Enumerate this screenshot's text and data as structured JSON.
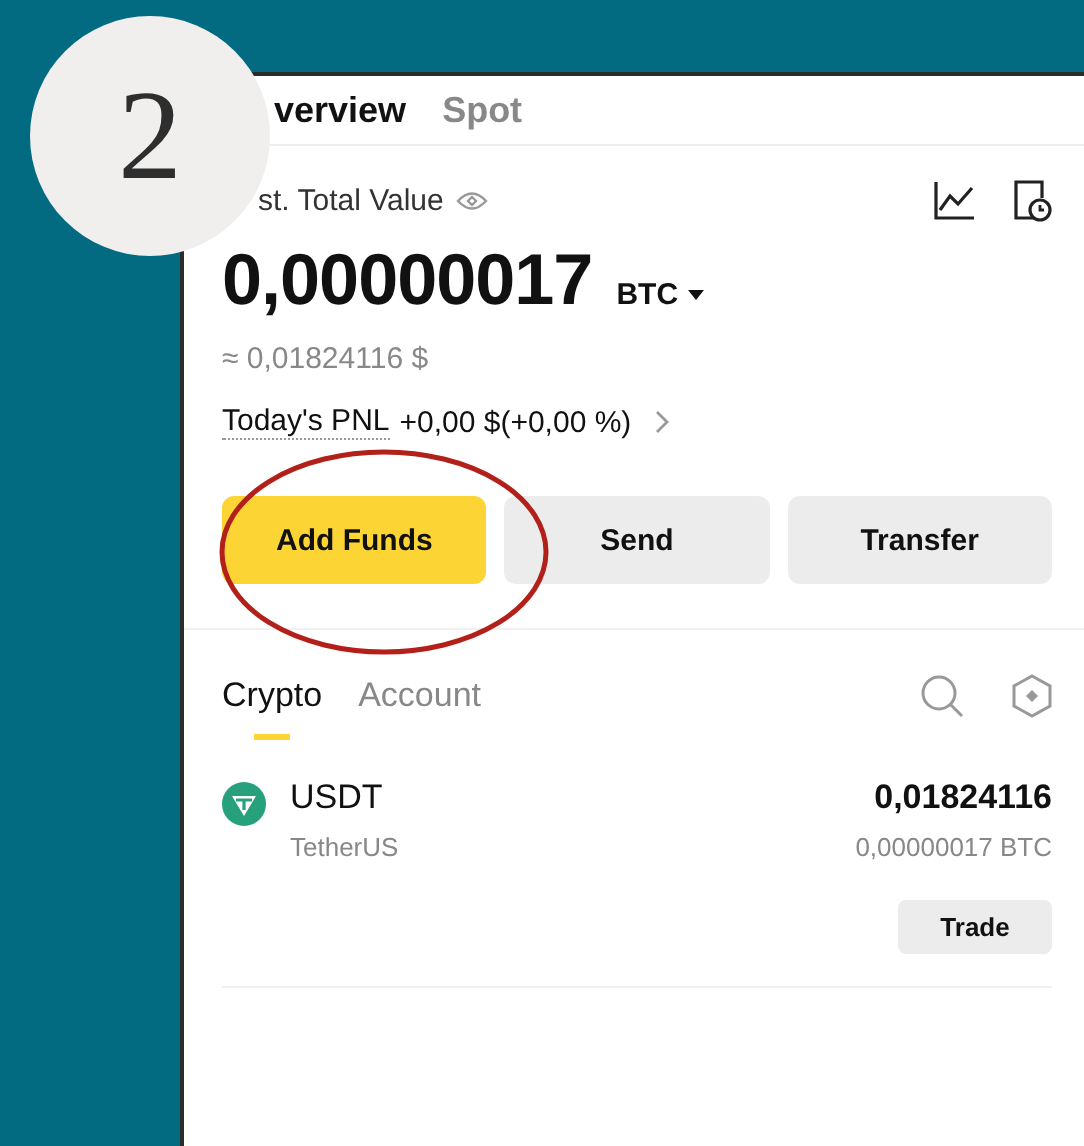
{
  "step_badge": {
    "text": "2"
  },
  "tabs": [
    {
      "label": "verview",
      "selected": true
    },
    {
      "label": "Spot",
      "selected": false
    }
  ],
  "total_value": {
    "label": "st. Total Value",
    "amount": "0,00000017",
    "currency": "BTC",
    "fiat": "≈ 0,01824116 $"
  },
  "pnl": {
    "label": "Today's PNL",
    "value": "+0,00 $(+0,00 %)"
  },
  "action_buttons": [
    {
      "label": "Add Funds",
      "kind": "primary",
      "highlighted": true
    },
    {
      "label": "Send",
      "kind": "secondary",
      "highlighted": false
    },
    {
      "label": "Transfer",
      "kind": "secondary",
      "highlighted": false
    }
  ],
  "asset_tabs": [
    {
      "label": "Crypto",
      "selected": true
    },
    {
      "label": "Account",
      "selected": false
    }
  ],
  "assets": [
    {
      "symbol": "USDT",
      "name": "TetherUS",
      "amount": "0,01824116",
      "btc_value": "0,00000017 BTC",
      "action": "Trade"
    }
  ]
}
